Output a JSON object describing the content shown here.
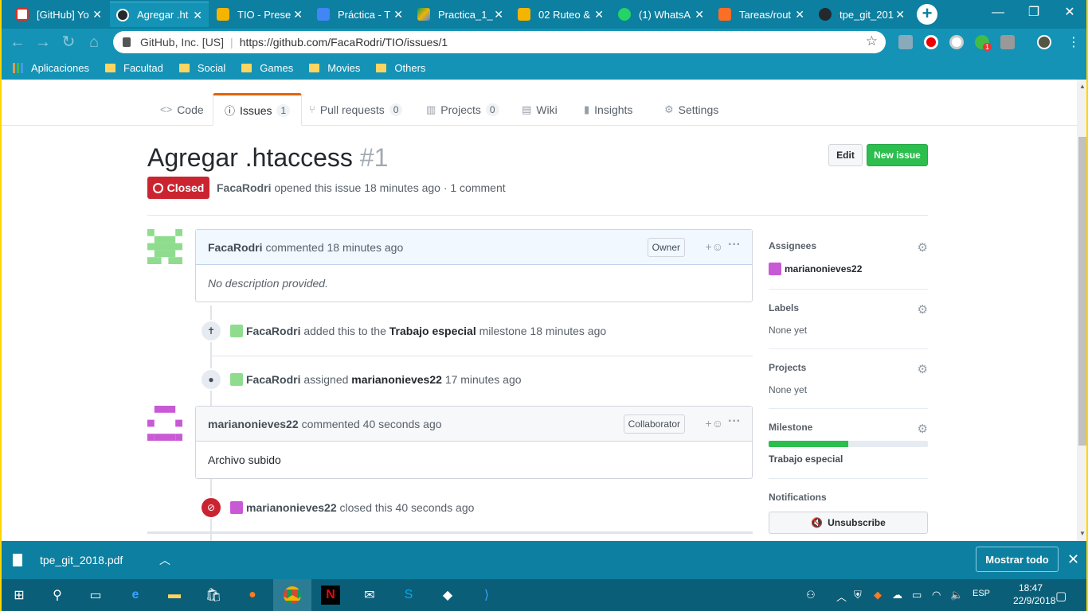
{
  "browser": {
    "tabs": [
      {
        "title": "[GitHub] Yo",
        "icon": "gmail-icon",
        "color": "#d93025"
      },
      {
        "title": "Agregar .ht",
        "icon": "github-icon",
        "color": "#24292e"
      },
      {
        "title": "TIO - Prese",
        "icon": "slides-icon",
        "color": "#f4b400"
      },
      {
        "title": "Práctica - T",
        "icon": "docs-icon",
        "color": "#4285f4"
      },
      {
        "title": "Practica_1_",
        "icon": "drive-icon",
        "color": "#0f9d58"
      },
      {
        "title": "02 Ruteo &",
        "icon": "slides-icon",
        "color": "#f4b400"
      },
      {
        "title": "(1) WhatsA",
        "icon": "whatsapp-icon",
        "color": "#25d366"
      },
      {
        "title": "Tareas/rout",
        "icon": "gitlab-icon",
        "color": "#fc6d26"
      },
      {
        "title": "tpe_git_201",
        "icon": "github-icon",
        "color": "#24292e"
      }
    ],
    "site_label": "GitHub, Inc. [US]",
    "url": "https://github.com/FacaRodri/TIO/issues/1",
    "bookmarks": [
      "Aplicaciones",
      "Facultad",
      "Social",
      "Games",
      "Movies",
      "Others"
    ],
    "extension_badge": "1"
  },
  "repo_nav": {
    "code": "Code",
    "issues": "Issues",
    "issues_count": "1",
    "pulls": "Pull requests",
    "pulls_count": "0",
    "projects": "Projects",
    "projects_count": "0",
    "wiki": "Wiki",
    "insights": "Insights",
    "settings": "Settings"
  },
  "issue": {
    "title": "Agregar .htaccess",
    "number": "#1",
    "edit_label": "Edit",
    "new_issue_label": "New issue",
    "state": "Closed",
    "author": "FacaRodri",
    "meta": "opened this issue 18 minutes ago · 1 comment"
  },
  "timeline": {
    "comment1": {
      "author": "FacaRodri",
      "time": "commented 18 minutes ago",
      "role": "Owner",
      "body": "No description provided."
    },
    "event_milestone": {
      "actor": "FacaRodri",
      "text1": "added this to the",
      "milestone": "Trabajo especial",
      "text2": "milestone 18 minutes ago"
    },
    "event_assigned": {
      "actor": "FacaRodri",
      "text1": "assigned",
      "assignee": "marianonieves22",
      "text2": "17 minutes ago"
    },
    "comment2": {
      "author": "marianonieves22",
      "time": "commented 40 seconds ago",
      "role": "Collaborator",
      "body": "Archivo subido"
    },
    "event_closed": {
      "actor": "marianonieves22",
      "text": "closed this 40 seconds ago"
    }
  },
  "sidebar": {
    "assignees_label": "Assignees",
    "assignee": "marianonieves22",
    "labels_label": "Labels",
    "labels_value": "None yet",
    "projects_label": "Projects",
    "projects_value": "None yet",
    "milestone_label": "Milestone",
    "milestone_progress": 0.5,
    "milestone_value": "Trabajo especial",
    "notifications_label": "Notifications",
    "unsubscribe_label": "Unsubscribe"
  },
  "download_bar": {
    "file": "tpe_git_2018.pdf",
    "show_all": "Mostrar todo"
  },
  "taskbar": {
    "lang": "ESP",
    "time": "18:47",
    "date": "22/9/2018"
  },
  "colors": {
    "accent_closed": "#cb2431",
    "new_issue": "#2cbe4e",
    "browser_teal": "#0d7fa0"
  }
}
